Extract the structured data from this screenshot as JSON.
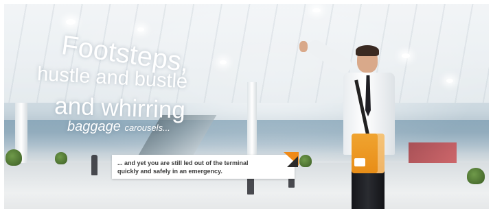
{
  "headline": {
    "line1": "Footsteps,",
    "line2": "hustle and bustle",
    "line3": "and whirring",
    "line4_main": "baggage",
    "line4_small": "carousels..."
  },
  "caption": {
    "line1": "... and yet you are still led out of the terminal",
    "line2": "quickly and safely in an emergency."
  },
  "colors": {
    "accent": "#f08a17",
    "text": "#ffffff"
  }
}
